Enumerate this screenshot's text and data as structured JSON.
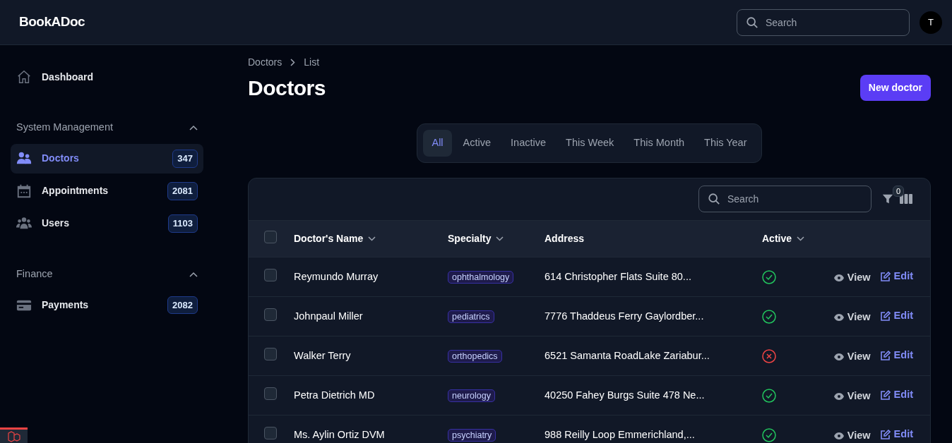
{
  "app": {
    "brand": "BookADoc",
    "search": {
      "placeholder": "Search"
    },
    "avatar": "T"
  },
  "sidebar": {
    "items": [
      {
        "label": "Dashboard",
        "selected": false
      }
    ],
    "groups": [
      {
        "title": "System Management",
        "expanded": true,
        "items": [
          {
            "label": "Doctors",
            "count": "347",
            "selected": true
          },
          {
            "label": "Appointments",
            "count": "2081",
            "selected": false
          },
          {
            "label": "Users",
            "count": "1103",
            "selected": false
          }
        ]
      },
      {
        "title": "Finance",
        "expanded": true,
        "items": [
          {
            "label": "Payments",
            "count": "2082",
            "selected": false
          }
        ]
      }
    ]
  },
  "breadcrumb": [
    "Doctors",
    "List"
  ],
  "page_title": "Doctors",
  "primary_action": "New doctor",
  "tabs": [
    {
      "label": "All",
      "selected": true
    },
    {
      "label": "Active",
      "selected": false
    },
    {
      "label": "Inactive",
      "selected": false
    },
    {
      "label": "This Week",
      "selected": false
    },
    {
      "label": "This Month",
      "selected": false
    },
    {
      "label": "This Year",
      "selected": false
    }
  ],
  "table": {
    "search": {
      "placeholder": "Search"
    },
    "filter_count": "0",
    "all_checked": false,
    "columns": [
      {
        "label": "Doctor's Name",
        "sortable": true
      },
      {
        "label": "Specialty",
        "sortable": true
      },
      {
        "label": "Address",
        "sortable": false
      },
      {
        "label": "Active",
        "sortable": true
      }
    ],
    "rows": [
      {
        "checked": false,
        "name": "Reymundo Murray",
        "specialty": "ophthalmology",
        "address": "614 Christopher Flats Suite 80...",
        "active": true,
        "actions": [
          "View",
          "Edit"
        ]
      },
      {
        "checked": false,
        "name": "Johnpaul Miller",
        "specialty": "pediatrics",
        "address": "7776 Thaddeus Ferry Gaylordber...",
        "active": true,
        "actions": [
          "View",
          "Edit"
        ]
      },
      {
        "checked": false,
        "name": "Walker Terry",
        "specialty": "orthopedics",
        "address": "6521 Samanta RoadLake Zariabur...",
        "active": false,
        "actions": [
          "View",
          "Edit"
        ]
      },
      {
        "checked": false,
        "name": "Petra Dietrich MD",
        "specialty": "neurology",
        "address": "40250 Fahey Burgs Suite 478 Ne...",
        "active": true,
        "actions": [
          "View",
          "Edit"
        ]
      },
      {
        "checked": false,
        "name": "Ms. Aylin Ortiz DVM",
        "specialty": "psychiatry",
        "address": "988 Reilly Loop Emmerichland,...",
        "active": true,
        "actions": [
          "View",
          "Edit"
        ]
      }
    ]
  }
}
